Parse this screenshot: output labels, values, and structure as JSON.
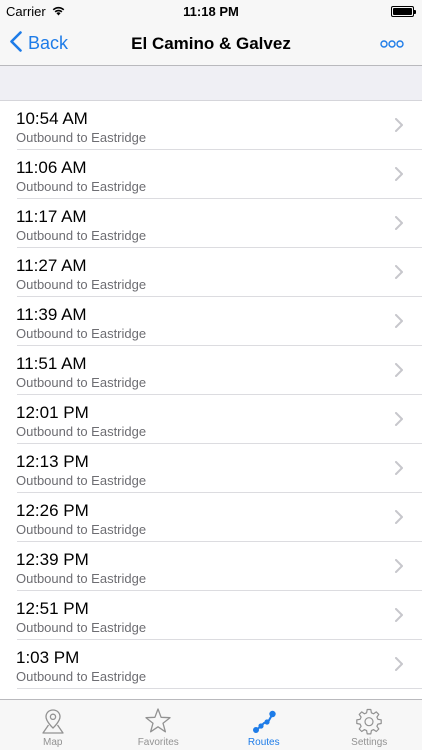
{
  "status_bar": {
    "carrier": "Carrier",
    "time": "11:18 PM"
  },
  "nav": {
    "back_label": "Back",
    "title": "El Camino & Galvez"
  },
  "departures": [
    {
      "time": "10:54 AM",
      "direction": "Outbound to Eastridge"
    },
    {
      "time": "11:06 AM",
      "direction": "Outbound to Eastridge"
    },
    {
      "time": "11:17 AM",
      "direction": "Outbound to Eastridge"
    },
    {
      "time": "11:27 AM",
      "direction": "Outbound to Eastridge"
    },
    {
      "time": "11:39 AM",
      "direction": "Outbound to Eastridge"
    },
    {
      "time": "11:51 AM",
      "direction": "Outbound to Eastridge"
    },
    {
      "time": "12:01 PM",
      "direction": "Outbound to Eastridge"
    },
    {
      "time": "12:13 PM",
      "direction": "Outbound to Eastridge"
    },
    {
      "time": "12:26 PM",
      "direction": "Outbound to Eastridge"
    },
    {
      "time": "12:39 PM",
      "direction": "Outbound to Eastridge"
    },
    {
      "time": "12:51 PM",
      "direction": "Outbound to Eastridge"
    },
    {
      "time": "1:03 PM",
      "direction": "Outbound to Eastridge"
    },
    {
      "time": "",
      "direction": ""
    }
  ],
  "tabs": [
    {
      "label": "Map",
      "icon": "map-pin-icon",
      "active": false
    },
    {
      "label": "Favorites",
      "icon": "star-icon",
      "active": false
    },
    {
      "label": "Routes",
      "icon": "routes-icon",
      "active": true
    },
    {
      "label": "Settings",
      "icon": "gear-icon",
      "active": false
    }
  ],
  "colors": {
    "accent": "#1e7ce8",
    "inactive": "#929292",
    "secondary_text": "#6d6d72",
    "bar_background": "#f7f7f7",
    "group_background": "#efeff4"
  }
}
